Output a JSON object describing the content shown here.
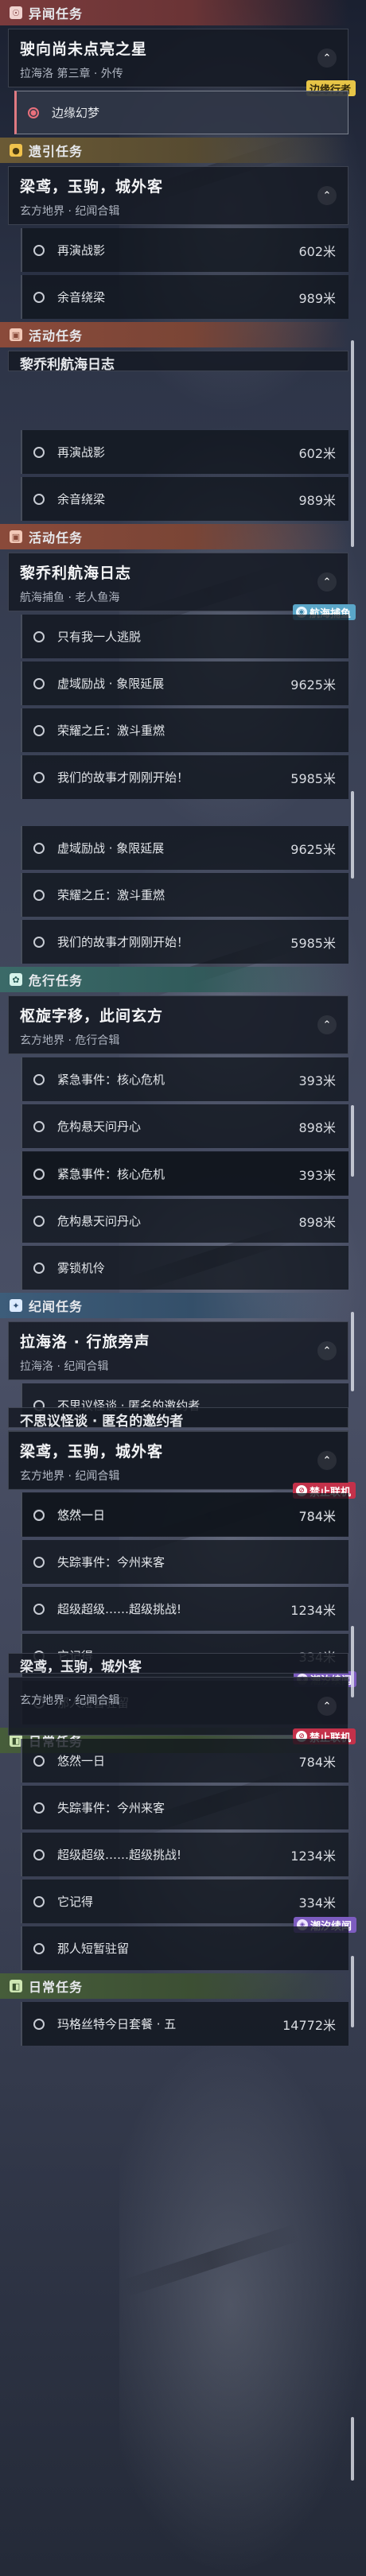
{
  "panels": [
    {
      "sections": [
        {
          "header": {
            "title": "异闻任务",
            "icon": "☉",
            "icon_name": "mystery-icon",
            "color": "red"
          },
          "quests": [
            {
              "title": "驶向尚未点亮之星",
              "subtitle": "拉海洛 第三章 · 外传",
              "expanded": true,
              "badge": {
                "label": "边缘行者",
                "style": "gold",
                "icon": "",
                "icon_name": ""
              },
              "steps": [
                {
                  "label": "边缘幻梦",
                  "distance": "",
                  "selected": true
                }
              ]
            }
          ]
        },
        {
          "header": {
            "title": "遗引任务",
            "icon": "●",
            "icon_name": "guide-icon",
            "color": "gold"
          },
          "quests": [
            {
              "title": "梁鸢，玉驹，城外客",
              "subtitle": "玄方地界 · 纪闻合辑",
              "expanded": true,
              "badge": null,
              "steps": [
                {
                  "label": "再演战影",
                  "distance": "602米"
                },
                {
                  "label": "余音绕梁",
                  "distance": "989米"
                }
              ]
            }
          ]
        },
        {
          "header": {
            "title": "活动任务",
            "icon": "▣",
            "icon_name": "event-icon",
            "color": "orange"
          },
          "partial_title": "黎乔利航海日志",
          "quests": []
        }
      ]
    },
    {
      "sections": [
        {
          "header": null,
          "quests": [
            {
              "title": null,
              "steps": [
                {
                  "label": "再演战影",
                  "distance": "602米"
                },
                {
                  "label": "余音绕梁",
                  "distance": "989米"
                }
              ]
            }
          ]
        },
        {
          "header": {
            "title": "活动任务",
            "icon": "▣",
            "icon_name": "event-icon",
            "color": "orange"
          },
          "quests": [
            {
              "title": "黎乔利航海日志",
              "subtitle": "航海捕鱼 · 老人鱼海",
              "expanded": true,
              "badge": {
                "label": "航海捕鱼",
                "style": "blue",
                "icon": "◉",
                "icon_name": "fishing-icon"
              },
              "steps": [
                {
                  "label": "只有我一人逃脱",
                  "distance": ""
                },
                {
                  "label": "虚域励战 · 象限延展",
                  "distance": "9625米"
                },
                {
                  "label": "荣耀之丘：激斗重燃",
                  "distance": ""
                },
                {
                  "label": "我们的故事才刚刚开始！",
                  "distance": "5985米"
                }
              ]
            }
          ]
        }
      ]
    },
    {
      "sections": [
        {
          "header": null,
          "quests": [
            {
              "title": null,
              "steps": [
                {
                  "label": "虚域励战 · 象限延展",
                  "distance": "9625米"
                },
                {
                  "label": "荣耀之丘：激斗重燃",
                  "distance": ""
                },
                {
                  "label": "我们的故事才刚刚开始！",
                  "distance": "5985米"
                }
              ]
            }
          ]
        },
        {
          "header": {
            "title": "危行任务",
            "icon": "✿",
            "icon_name": "danger-icon",
            "color": "teal"
          },
          "quests": [
            {
              "title": "枢旋字移，此间玄方",
              "subtitle": "玄方地界 · 危行合辑",
              "expanded": true,
              "badge": null,
              "steps": [
                {
                  "label": "紧急事件：核心危机",
                  "distance": "393米"
                },
                {
                  "label": "危构悬天问丹心",
                  "distance": "898米"
                },
                {
                  "label": "雾锁机伶",
                  "distance": ""
                }
              ]
            }
          ]
        }
      ]
    },
    {
      "sections": [
        {
          "header": null,
          "quests": [
            {
              "title": null,
              "steps": [
                {
                  "label": "紧急事件：核心危机",
                  "distance": "393米"
                },
                {
                  "label": "危构悬天问丹心",
                  "distance": "898米"
                },
                {
                  "label": "雾锁机伶",
                  "distance": ""
                }
              ]
            }
          ]
        },
        {
          "header": {
            "title": "纪闻任务",
            "icon": "✦",
            "icon_name": "chronicle-icon",
            "color": "blue"
          },
          "quests": [
            {
              "title": "拉海洛 · 行旅旁声",
              "subtitle": "拉海洛 · 纪闻合辑",
              "expanded": true,
              "badge": null,
              "steps": [
                {
                  "label": "不思议怪谈 · 匿名的邀约者",
                  "distance": ""
                }
              ]
            },
            {
              "title": "梁鸢，玉驹，城外客",
              "subtitle": "玄方地界 · 纪闻合辑",
              "expanded": true,
              "badge": {
                "label": "禁止联机",
                "style": "red",
                "icon": "⊘",
                "icon_name": "no-coop-icon"
              },
              "steps": [
                {
                  "label": "悠然一日",
                  "distance": "784米"
                }
              ]
            }
          ]
        }
      ]
    },
    {
      "sections": [
        {
          "header": null,
          "partial_title": "不思议怪谈 · 匿名的邀约者",
          "quests": [
            {
              "title": "梁鸢，玉驹，城外客",
              "subtitle": "玄方地界 · 纪闻合辑",
              "expanded": true,
              "badge": {
                "label": "禁止联机",
                "style": "red",
                "icon": "⊘",
                "icon_name": "no-coop-icon"
              },
              "steps": [
                {
                  "label": "悠然一日",
                  "distance": "784米"
                },
                {
                  "label": "失踪事件：今州来客",
                  "distance": ""
                },
                {
                  "label": "超级超级……超级挑战!",
                  "distance": "1234米"
                },
                {
                  "label": "它记得",
                  "distance": "334米",
                  "badge": {
                    "label": "潮汐续闻",
                    "style": "purple",
                    "icon": "◈",
                    "icon_name": "tide-icon"
                  }
                },
                {
                  "label": "那人短暂驻留",
                  "distance": ""
                }
              ]
            }
          ]
        },
        {
          "header": {
            "title": "日常任务",
            "icon": "◧",
            "icon_name": "daily-icon",
            "color": "green"
          },
          "quests": []
        }
      ]
    },
    {
      "sections": [
        {
          "header": null,
          "partial_title": "梁鸢，玉驹，城外客",
          "quests": [
            {
              "title": null,
              "subtitle": "玄方地界 · 纪闻合辑",
              "expanded": true,
              "badge": {
                "label": "禁止联机",
                "style": "red",
                "icon": "⊘",
                "icon_name": "no-coop-icon"
              },
              "steps": [
                {
                  "label": "悠然一日",
                  "distance": "784米"
                },
                {
                  "label": "失踪事件：今州来客",
                  "distance": ""
                },
                {
                  "label": "超级超级……超级挑战!",
                  "distance": "1234米"
                },
                {
                  "label": "它记得",
                  "distance": "334米",
                  "badge": {
                    "label": "潮汐续闻",
                    "style": "purple",
                    "icon": "◈",
                    "icon_name": "tide-icon"
                  }
                },
                {
                  "label": "那人短暂驻留",
                  "distance": ""
                }
              ]
            }
          ]
        },
        {
          "header": {
            "title": "日常任务",
            "icon": "◧",
            "icon_name": "daily-icon",
            "color": "green"
          },
          "quests": [
            {
              "title": null,
              "steps": [
                {
                  "label": "玛格丝特今日套餐 · 五",
                  "distance": "14772米"
                }
              ]
            }
          ]
        }
      ]
    }
  ]
}
